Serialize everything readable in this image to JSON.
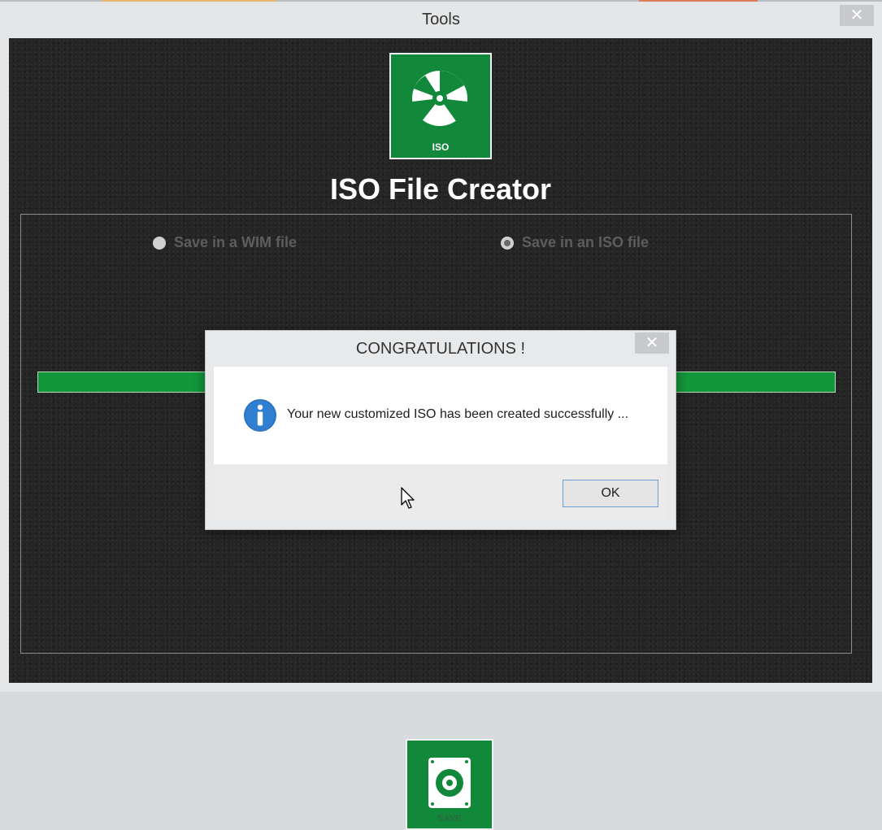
{
  "window": {
    "title": "Tools",
    "close_glyph": "✕"
  },
  "app": {
    "title": "ISO File Creator",
    "iso_icon": "disc-icon",
    "iso_caption": "ISO",
    "options": [
      {
        "label": "Save in a WIM file",
        "checked": false
      },
      {
        "label": "Save in an ISO file",
        "checked": true
      }
    ],
    "progress": 1.0,
    "save_icon": "disk-save-icon",
    "save_caption": "SAVE"
  },
  "dialog": {
    "title": "CONGRATULATIONS !",
    "close_glyph": "✕",
    "message": "Your new customized ISO has been created successfully ...",
    "icon": "info-icon",
    "ok_label": "OK"
  },
  "colors": {
    "accent_green": "#12883a",
    "progress_green": "#12983a",
    "info_blue": "#2f74c0"
  }
}
